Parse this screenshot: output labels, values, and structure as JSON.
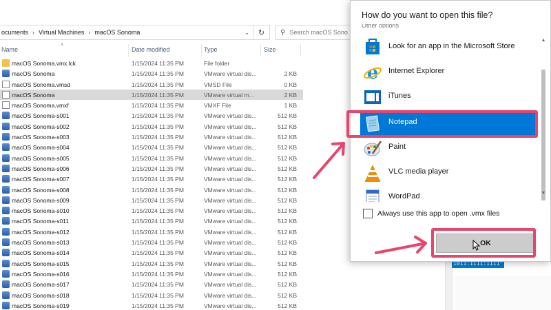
{
  "explorer": {
    "breadcrumbs": [
      "ocuments",
      "Virtual Machines",
      "macOS Sonoma"
    ],
    "search_placeholder": "Search macOS Sono",
    "columns": {
      "name": "Name",
      "date": "Date modified",
      "type": "Type",
      "size": "Size"
    },
    "files": [
      {
        "name": "macOS Sonoma.vmx.lck",
        "date": "1/15/2024 11:35 PM",
        "type": "File folder",
        "size": "",
        "icon": "folder-icon"
      },
      {
        "name": "macOS Sonoma",
        "date": "1/15/2024 11:35 PM",
        "type": "VMware virtual dis...",
        "size": "2 KB",
        "icon": "disk-icon"
      },
      {
        "name": "macOS Sonoma.vmsd",
        "date": "1/15/2024 11:35 PM",
        "type": "VMSD File",
        "size": "0 KB",
        "icon": "document-icon"
      },
      {
        "name": "macOS Sonoma",
        "date": "1/15/2024 11:35 PM",
        "type": "VMware virtual m...",
        "size": "2 KB",
        "icon": "vm-config-icon"
      },
      {
        "name": "macOS Sonoma.vmxf",
        "date": "1/15/2024 11:35 PM",
        "type": "VMXF File",
        "size": "1 KB",
        "icon": "document-icon"
      },
      {
        "name": "macOS Sonoma-s001",
        "date": "1/15/2024 11:35 PM",
        "type": "VMware virtual dis...",
        "size": "512 KB",
        "icon": "disk-icon"
      },
      {
        "name": "macOS Sonoma-s002",
        "date": "1/15/2024 11:35 PM",
        "type": "VMware virtual dis...",
        "size": "512 KB",
        "icon": "disk-icon"
      },
      {
        "name": "macOS Sonoma-s003",
        "date": "1/15/2024 11:35 PM",
        "type": "VMware virtual dis...",
        "size": "512 KB",
        "icon": "disk-icon"
      },
      {
        "name": "macOS Sonoma-s004",
        "date": "1/15/2024 11:35 PM",
        "type": "VMware virtual dis...",
        "size": "512 KB",
        "icon": "disk-icon"
      },
      {
        "name": "macOS Sonoma-s005",
        "date": "1/15/2024 11:35 PM",
        "type": "VMware virtual dis...",
        "size": "512 KB",
        "icon": "disk-icon"
      },
      {
        "name": "macOS Sonoma-s006",
        "date": "1/15/2024 11:35 PM",
        "type": "VMware virtual dis...",
        "size": "512 KB",
        "icon": "disk-icon"
      },
      {
        "name": "macOS Sonoma-s007",
        "date": "1/15/2024 11:35 PM",
        "type": "VMware virtual dis...",
        "size": "512 KB",
        "icon": "disk-icon"
      },
      {
        "name": "macOS Sonoma-s008",
        "date": "1/15/2024 11:35 PM",
        "type": "VMware virtual dis...",
        "size": "512 KB",
        "icon": "disk-icon"
      },
      {
        "name": "macOS Sonoma-s009",
        "date": "1/15/2024 11:35 PM",
        "type": "VMware virtual dis...",
        "size": "512 KB",
        "icon": "disk-icon"
      },
      {
        "name": "macOS Sonoma-s010",
        "date": "1/15/2024 11:35 PM",
        "type": "VMware virtual dis...",
        "size": "512 KB",
        "icon": "disk-icon"
      },
      {
        "name": "macOS Sonoma-s011",
        "date": "1/15/2024 11:35 PM",
        "type": "VMware virtual dis...",
        "size": "512 KB",
        "icon": "disk-icon"
      },
      {
        "name": "macOS Sonoma-s012",
        "date": "1/15/2024 11:35 PM",
        "type": "VMware virtual dis...",
        "size": "512 KB",
        "icon": "disk-icon"
      },
      {
        "name": "macOS Sonoma-s013",
        "date": "1/15/2024 11:35 PM",
        "type": "VMware virtual dis...",
        "size": "512 KB",
        "icon": "disk-icon"
      },
      {
        "name": "macOS Sonoma-s014",
        "date": "1/15/2024 11:35 PM",
        "type": "VMware virtual dis...",
        "size": "512 KB",
        "icon": "disk-icon"
      },
      {
        "name": "macOS Sonoma-s015",
        "date": "1/15/2024 11:35 PM",
        "type": "VMware virtual dis...",
        "size": "512 KB",
        "icon": "disk-icon"
      },
      {
        "name": "macOS Sonoma-s016",
        "date": "1/15/2024 11:35 PM",
        "type": "VMware virtual dis...",
        "size": "512 KB",
        "icon": "disk-icon"
      },
      {
        "name": "macOS Sonoma-s017",
        "date": "1/15/2024 11:35 PM",
        "type": "VMware virtual dis...",
        "size": "512 KB",
        "icon": "disk-icon"
      },
      {
        "name": "macOS Sonoma-s018",
        "date": "1/15/2024 11:35 PM",
        "type": "VMware virtual dis...",
        "size": "512 KB",
        "icon": "disk-icon"
      },
      {
        "name": "macOS Sonoma-s019",
        "date": "1/15/2024 11:35 PM",
        "type": "VMware virtual dis...",
        "size": "512 KB",
        "icon": "disk-icon"
      }
    ],
    "selected_row": 3,
    "background_code": "1011:1111:1111\""
  },
  "dialog": {
    "title": "How do you want to open this file?",
    "subtitle": "Other options",
    "apps": [
      {
        "label": "Look for an app in the Microsoft Store",
        "icon": "microsoft-store-icon"
      },
      {
        "label": "Internet Explorer",
        "icon": "internet-explorer-icon"
      },
      {
        "label": "iTunes",
        "icon": "itunes-icon"
      },
      {
        "label": "Notepad",
        "icon": "notepad-icon"
      },
      {
        "label": "Paint",
        "icon": "paint-icon"
      },
      {
        "label": "VLC media player",
        "icon": "vlc-icon"
      },
      {
        "label": "WordPad",
        "icon": "wordpad-icon"
      }
    ],
    "selected_app": "Notepad",
    "always_use_label": "Always use this app to open .vmx files",
    "always_use_checked": false,
    "ok_label": "OK"
  },
  "colors": {
    "selection_blue": "#0078d7",
    "highlight_pink": "#e8456c",
    "selected_row_gray": "#d9d9d9"
  }
}
